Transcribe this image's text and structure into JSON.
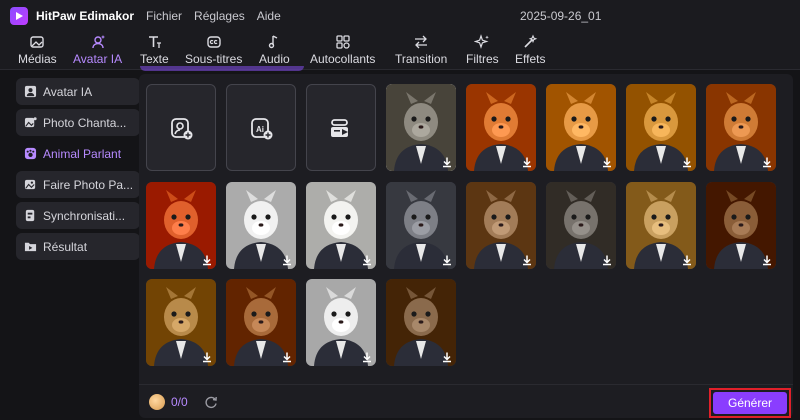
{
  "app": {
    "name": "HitPaw Edimakor",
    "project": "2025-09-26_01"
  },
  "menu": [
    "Fichier",
    "Réglages",
    "Aide"
  ],
  "toolbar": {
    "items": [
      {
        "label": "Médias",
        "icon": "image-icon"
      },
      {
        "label": "Avatar IA",
        "icon": "avatar-ai-icon",
        "active": true
      },
      {
        "label": "Texte",
        "icon": "text-icon"
      },
      {
        "label": "Sous-titres",
        "icon": "subtitles-icon"
      },
      {
        "label": "Audio",
        "icon": "music-note-icon"
      },
      {
        "label": "Autocollants",
        "icon": "stickers-icon"
      },
      {
        "label": "Transition",
        "icon": "transition-arrows-icon"
      },
      {
        "label": "Filtres",
        "icon": "sparkle-icon"
      },
      {
        "label": "Effets",
        "icon": "effects-wand-icon"
      }
    ]
  },
  "sidebar": {
    "items": [
      {
        "label": "Avatar IA",
        "icon": "person-icon"
      },
      {
        "label": "Photo Chanta...",
        "icon": "photo-sing-icon"
      },
      {
        "label": "Animal Parlant",
        "icon": "paw-icon",
        "active": true
      },
      {
        "label": "Faire Photo Pa...",
        "icon": "photo-talk-icon"
      },
      {
        "label": "Synchronisati...",
        "icon": "lipsync-icon"
      },
      {
        "label": "Résultat",
        "icon": "folder-icon"
      }
    ]
  },
  "grid": {
    "actions": [
      {
        "icon": "upload-avatar-icon"
      },
      {
        "icon": "ai-generate-image-icon"
      },
      {
        "icon": "text-to-video-icon"
      }
    ],
    "avatars": [
      {
        "subject": "cat",
        "color": "#8e8a80",
        "selected": true
      },
      {
        "subject": "fox",
        "color": "#e07b34"
      },
      {
        "subject": "cat",
        "color": "#e79a45"
      },
      {
        "subject": "dog",
        "color": "#d9983d"
      },
      {
        "subject": "dog",
        "color": "#cf7b35"
      },
      {
        "subject": "fox",
        "color": "#e0602c"
      },
      {
        "subject": "panda",
        "color": "#f1f1f1"
      },
      {
        "subject": "panda",
        "color": "#f3f3f0"
      },
      {
        "subject": "raccoon",
        "color": "#7d7f86"
      },
      {
        "subject": "kangaroo",
        "color": "#a27c58"
      },
      {
        "subject": "wolf",
        "color": "#77726c"
      },
      {
        "subject": "leopard",
        "color": "#c9a060"
      },
      {
        "subject": "bear",
        "color": "#8a5d38"
      },
      {
        "subject": "lion",
        "color": "#b88a4a"
      },
      {
        "subject": "dog",
        "color": "#a86a3a"
      },
      {
        "subject": "panda",
        "color": "#eeeeee"
      },
      {
        "subject": "beaver",
        "color": "#8a6a4c"
      }
    ]
  },
  "footer": {
    "credits": "0/0",
    "generate_label": "Générer"
  },
  "colors": {
    "accent": "#8a3dff",
    "highlight": "#e0202a",
    "bg": "#141417"
  }
}
